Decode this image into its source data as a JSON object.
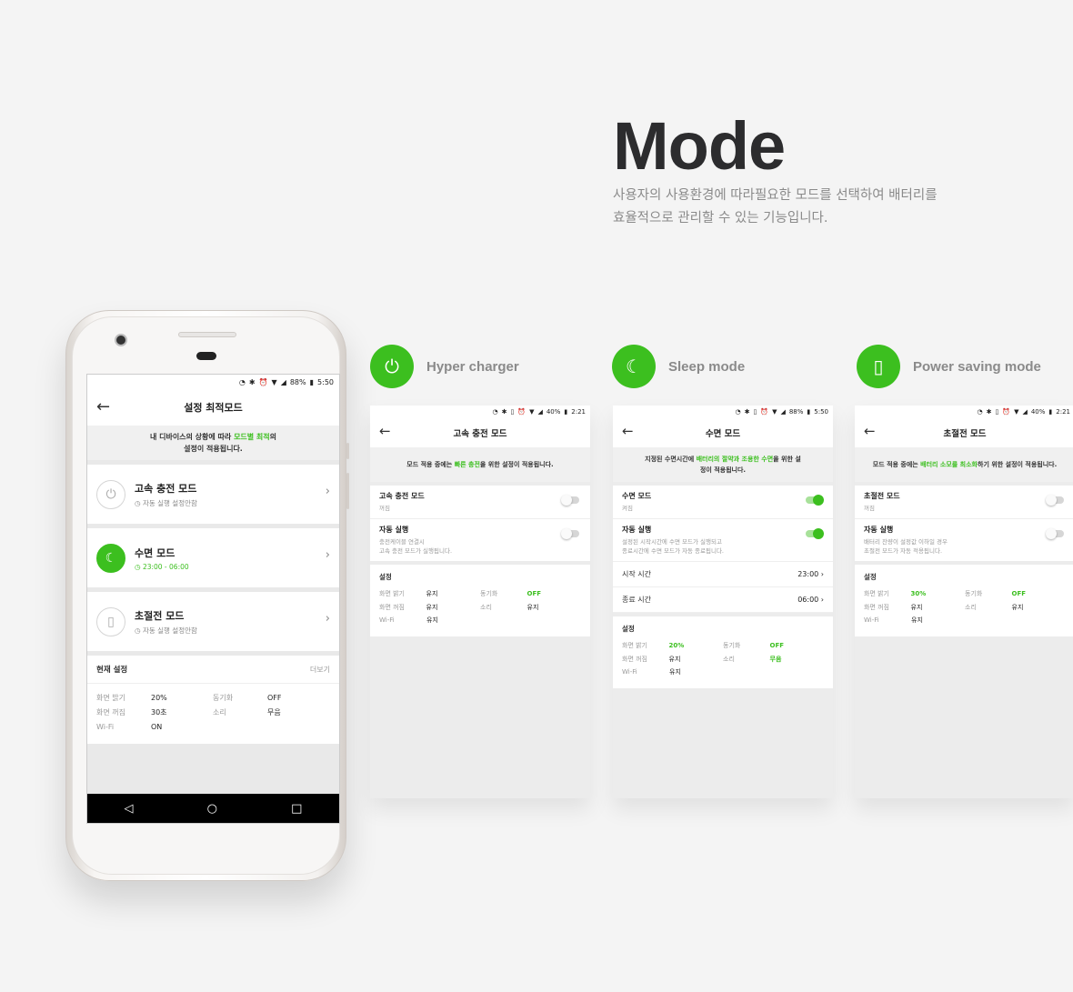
{
  "hero": {
    "title": "Mode",
    "desc_line1": "사용자의 사용환경에 따라필요한 모드를 선택하여 배터리를",
    "desc_line2": "효율적으로 관리할 수 있는 기능입니다."
  },
  "colors": {
    "accent": "#3cbf1f",
    "background": "#f4f4f4"
  },
  "phone": {
    "status": {
      "battery": "88%",
      "time": "5:50"
    },
    "title": "설정 최적모드",
    "banner_a": "내 디바이스의 상황에 따라 ",
    "banner_b": "모드별 최적",
    "banner_c": "의",
    "banner_d": "설정이 적용됩니다.",
    "modes": [
      {
        "name": "고속 충전 모드",
        "sub": "자동 실행 설정안함",
        "icon": "plug-icon"
      },
      {
        "name": "수면 모드",
        "sub": "23:00 - 06:00",
        "icon": "moon-icon"
      },
      {
        "name": "초절전 모드",
        "sub": "자동 실행 설정안함",
        "icon": "battery-recycle-icon"
      }
    ],
    "current": {
      "title": "현재 설정",
      "more": "더보기",
      "rows": [
        {
          "k1": "화면 밝기",
          "v1": "20%",
          "k2": "동기화",
          "v2": "OFF"
        },
        {
          "k1": "화면 꺼짐",
          "v1": "30초",
          "k2": "소리",
          "v2": "무음"
        },
        {
          "k1": "Wi-Fi",
          "v1": "ON",
          "k2": "",
          "v2": ""
        }
      ]
    }
  },
  "features": {
    "hyper": {
      "label": "Hyper charger",
      "status_battery": "40%",
      "status_time": "2:21",
      "title": "고속 충전 모드",
      "banner_a": "모드 적용 중에는 ",
      "banner_b": "빠른 충전",
      "banner_c": "을 위한 설정이 적용됩니다.",
      "row1_name": "고속 충전 모드",
      "row1_sub": "꺼짐",
      "row2_name": "자동 실행",
      "row2_sub1": "충전케이블 연결시",
      "row2_sub2": "고속 충전 모드가 실행됩니다.",
      "set_title": "설정",
      "rows": [
        {
          "k1": "화면 밝기",
          "v1": "유지",
          "k2": "동기화",
          "v2": "OFF"
        },
        {
          "k1": "화면 꺼짐",
          "v1": "유지",
          "k2": "소리",
          "v2": "유지"
        },
        {
          "k1": "Wi-Fi",
          "v1": "유지",
          "k2": "",
          "v2": ""
        }
      ]
    },
    "sleep": {
      "label": "Sleep mode",
      "status_battery": "88%",
      "status_time": "5:50",
      "title": "수면 모드",
      "banner_a": "지정된 수면시간에 ",
      "banner_b": "배터리의 절약과 조용한 수면",
      "banner_c": "을 위한 설",
      "banner_d": "정이 적용됩니다.",
      "row1_name": "수면 모드",
      "row1_sub": "켜짐",
      "row2_name": "자동 실행",
      "row2_sub1": "설정된 시작시간에 수면 모드가 실행되고",
      "row2_sub2": "종료시간에 수면 모드가 자동 종료됩니다.",
      "start_label": "시작 시간",
      "start_value": "23:00",
      "end_label": "종료 시간",
      "end_value": "06:00",
      "set_title": "설정",
      "rows": [
        {
          "k1": "화면 밝기",
          "v1": "20%",
          "k2": "동기화",
          "v2": "OFF"
        },
        {
          "k1": "화면 꺼짐",
          "v1": "유지",
          "k2": "소리",
          "v2": "무음"
        },
        {
          "k1": "Wi-Fi",
          "v1": "유지",
          "k2": "",
          "v2": ""
        }
      ]
    },
    "power": {
      "label": "Power saving mode",
      "status_battery": "40%",
      "status_time": "2:21",
      "title": "초절전 모드",
      "banner_a": "모드 적용 중에는 ",
      "banner_b": "배터리 소모를 최소화",
      "banner_c": "하기 위한 설정이 적용됩니다.",
      "row1_name": "초절전 모드",
      "row1_sub": "꺼짐",
      "row2_name": "자동 실행",
      "row2_sub1": "배터리 잔량이 설정값 이하일 경우",
      "row2_sub2": "초절전 모드가 자동 적용됩니다.",
      "set_title": "설정",
      "rows": [
        {
          "k1": "화면 밝기",
          "v1": "30%",
          "k2": "동기화",
          "v2": "OFF"
        },
        {
          "k1": "화면 꺼짐",
          "v1": "유지",
          "k2": "소리",
          "v2": "유지"
        },
        {
          "k1": "Wi-Fi",
          "v1": "유지",
          "k2": "",
          "v2": ""
        }
      ]
    }
  }
}
